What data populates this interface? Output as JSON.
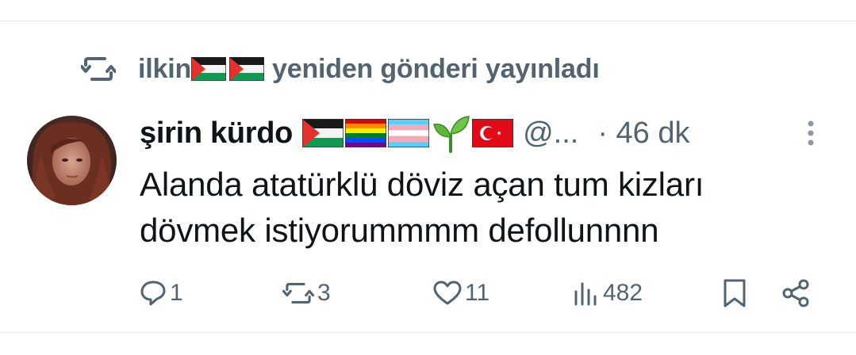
{
  "repost_header": {
    "user": "ilkin",
    "action_text": "yeniden gönderi yayınladı",
    "icon": "repost-icon"
  },
  "tweet": {
    "author_name": "şirin kürdo",
    "author_handle": "@...",
    "time": "· 46 dk",
    "text_lines": [
      "Alanda atatürklü döviz açan tum kizları",
      "dövmek istiyorummmm defollunnnn"
    ],
    "flags": [
      "palestine-flag",
      "rainbow-flag",
      "transgender-flag",
      "seedling",
      "turkey-flag"
    ]
  },
  "actions": {
    "reply_count": "1",
    "repost_count": "3",
    "like_count": "11",
    "view_count": "482"
  },
  "colors": {
    "text_primary": "#0f1419",
    "text_secondary": "#536471",
    "divider": "#e6e9eb"
  }
}
